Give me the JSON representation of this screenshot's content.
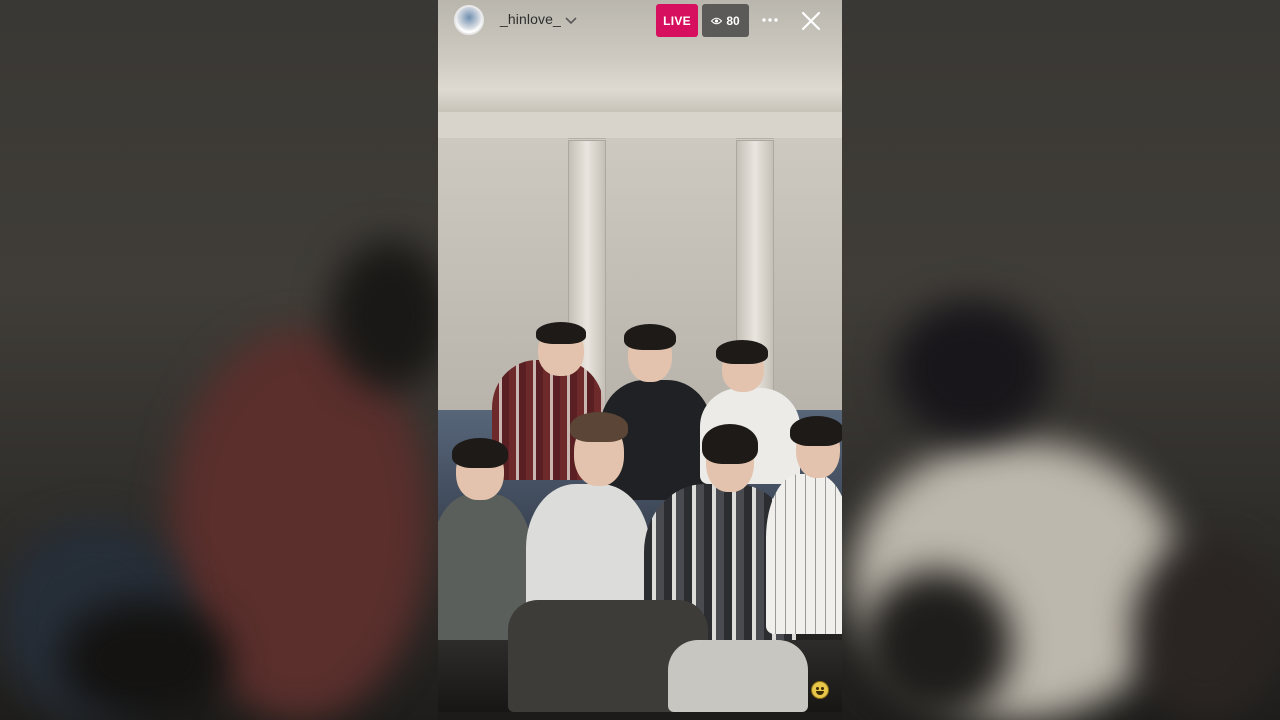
{
  "stream": {
    "username": "_hinlove_",
    "live_label": "LIVE",
    "viewer_count": "80"
  },
  "icons": {
    "avatar": "profile-avatar",
    "username_chevron": "chevron-down-icon",
    "viewers": "eye-icon",
    "more": "more-horizontal-icon",
    "close": "close-icon",
    "reaction": "grinning-emoji-icon"
  },
  "colors": {
    "live_badge": "#d6105e",
    "viewer_badge": "#5b5a58"
  }
}
